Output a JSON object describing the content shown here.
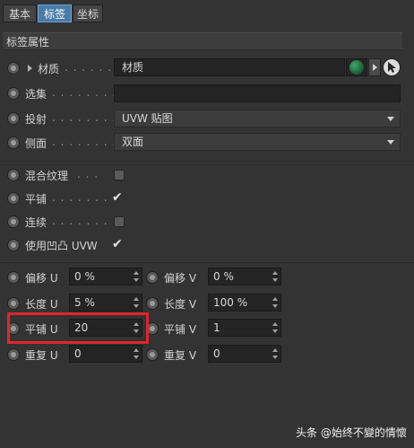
{
  "tabs": [
    {
      "label": "基本"
    },
    {
      "label": "标签"
    },
    {
      "label": "坐标"
    }
  ],
  "section_title": "标签属性",
  "rows": {
    "material": {
      "label": "材质",
      "dots": ". . . . . . .",
      "value": "材质"
    },
    "selection": {
      "label": "选集",
      "dots": ". . . . . . . .",
      "value": ""
    },
    "projection": {
      "label": "投射",
      "dots": ". . . . . . . .",
      "value": "UVW 贴图"
    },
    "side": {
      "label": "侧面",
      "dots": ". . . . . . . .",
      "value": "双面"
    }
  },
  "options": {
    "mix_textures": {
      "label": "混合纹理",
      "dots": ". . .",
      "checked": false
    },
    "tile": {
      "label": "平铺",
      "dots": ". . . . . . .",
      "checked": true,
      "check_mark": "✔"
    },
    "seamless": {
      "label": "连续",
      "dots": ". . . . . . .",
      "checked": false
    },
    "use_bump_uvw": {
      "label": "使用凹凸 UVW",
      "checked": true,
      "check_mark": "✔"
    }
  },
  "params": {
    "offset_u": {
      "label": "偏移 U",
      "value": "0 %"
    },
    "offset_v": {
      "label": "偏移 V",
      "value": "0 %"
    },
    "length_u": {
      "label": "长度 U",
      "value": "5 %"
    },
    "length_v": {
      "label": "长度 V",
      "value": "100 %"
    },
    "tiles_u": {
      "label": "平铺 U",
      "value": "20"
    },
    "tiles_v": {
      "label": "平铺 V",
      "value": "1"
    },
    "repeat_u": {
      "label": "重复 U",
      "value": "0"
    },
    "repeat_v": {
      "label": "重复 V",
      "value": "0"
    }
  },
  "watermark": "头条 @始终不變的情懷",
  "colors": {
    "highlight": "#e0252a",
    "active_tab": "#4a7ba8",
    "material_swatch": "#1e6b3e"
  }
}
